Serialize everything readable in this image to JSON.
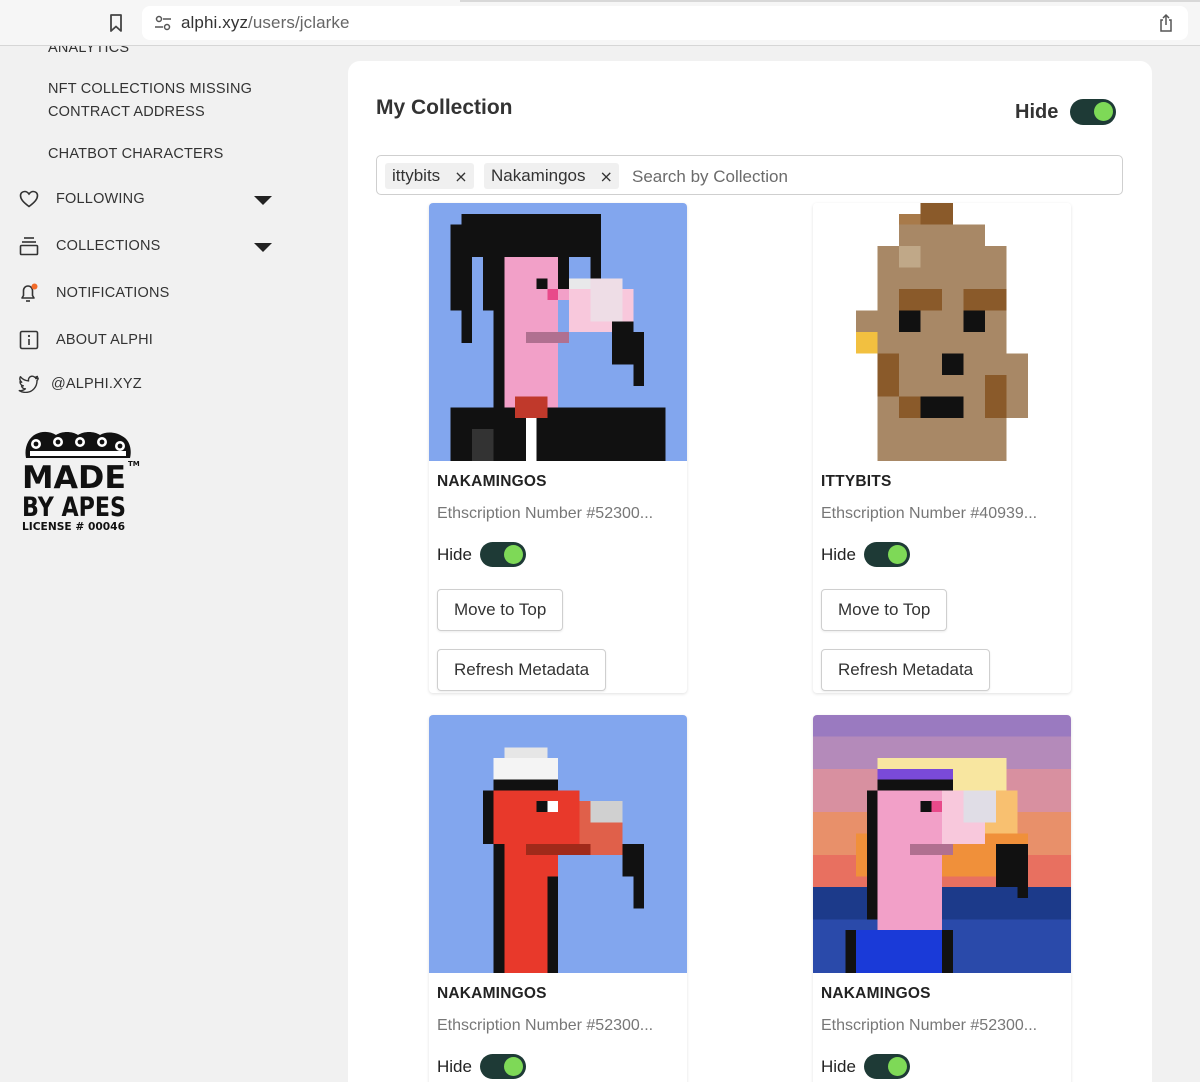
{
  "browser": {
    "url_host": "alphi.xyz",
    "url_path": "/users/jclarke"
  },
  "sidebar": {
    "subitems": [
      {
        "label": "ANALYTICS"
      },
      {
        "label_line1": "NFT COLLECTIONS MISSING",
        "label_line2": "CONTRACT ADDRESS"
      },
      {
        "label": "CHATBOT CHARACTERS"
      }
    ],
    "items": [
      {
        "label": "FOLLOWING",
        "icon": "heart-icon"
      },
      {
        "label": "COLLECTIONS",
        "icon": "stack-icon"
      },
      {
        "label": "NOTIFICATIONS",
        "icon": "bell-icon"
      },
      {
        "label": "ABOUT ALPHI",
        "icon": "info-icon"
      },
      {
        "label": "@ALPHI.XYZ",
        "icon": "twitter-icon"
      }
    ],
    "logo": {
      "line1": "MADE",
      "line2": "BY APES",
      "line3": "LICENSE # 00046",
      "tm": "TM"
    }
  },
  "main": {
    "title": "My Collection",
    "hide_label": "Hide",
    "search": {
      "chips": [
        "ittybits",
        "Nakamingos"
      ],
      "placeholder": "Search by Collection"
    },
    "cards": [
      {
        "name": "NAKAMINGOS",
        "number": "Ethscription Number #52300...",
        "hide_label": "Hide",
        "move_label": "Move to Top",
        "refresh_label": "Refresh Metadata"
      },
      {
        "name": "ITTYBITS",
        "number": "Ethscription Number #40939...",
        "hide_label": "Hide",
        "move_label": "Move to Top",
        "refresh_label": "Refresh Metadata"
      },
      {
        "name": "NAKAMINGOS",
        "number": "Ethscription Number #52300...",
        "hide_label": "Hide"
      },
      {
        "name": "NAKAMINGOS",
        "number": "Ethscription Number #52300...",
        "hide_label": "Hide"
      }
    ]
  },
  "colors": {
    "toggle_track": "#1e3a36",
    "toggle_knob": "#7ed957",
    "nft_blue_bg": "#82a6ee",
    "flamingo_pink": "#f2a0c8",
    "flamingo_red": "#e8392b"
  }
}
